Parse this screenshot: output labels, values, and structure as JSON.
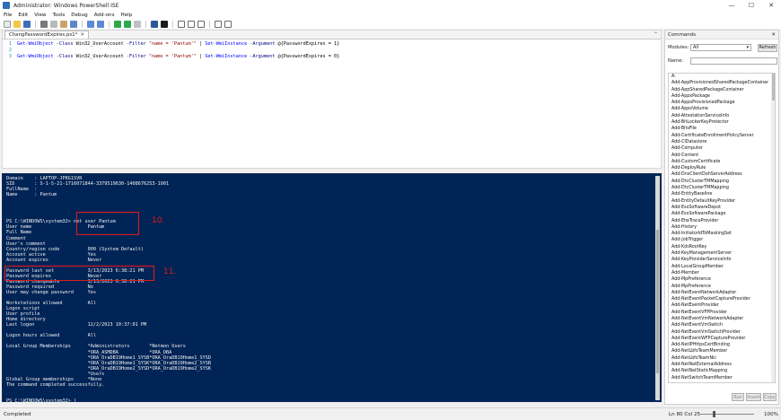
{
  "window": {
    "title": "Administrator: Windows PowerShell ISE",
    "controls": {
      "minimize": "—",
      "maximize": "☐",
      "close": "✕"
    }
  },
  "menu": [
    "File",
    "Edit",
    "View",
    "Tools",
    "Debug",
    "Add-ons",
    "Help"
  ],
  "editor": {
    "tab_label": "ChangPasswordExpires.ps1*",
    "tab_close": "✕",
    "collapse_glyph": "⌃",
    "lines": [
      {
        "n": "1",
        "parts": [
          {
            "c": "cmd",
            "t": "Get-WmiObject"
          },
          {
            "c": "param",
            "t": " -Class "
          },
          {
            "c": "plain",
            "t": "Win32_UserAccount"
          },
          {
            "c": "param",
            "t": " -Filter "
          },
          {
            "c": "str",
            "t": "\"name = 'Pantum'\""
          },
          {
            "c": "plain",
            "t": " | "
          },
          {
            "c": "cmd",
            "t": "Set-WmiInstance"
          },
          {
            "c": "param",
            "t": " -Argument "
          },
          {
            "c": "plain",
            "t": "@{PasswordExpires = 1}"
          }
        ]
      },
      {
        "n": "2",
        "parts": []
      },
      {
        "n": "3",
        "parts": [
          {
            "c": "cmd",
            "t": "Get-WmiObject"
          },
          {
            "c": "param",
            "t": " -Class "
          },
          {
            "c": "plain",
            "t": "Win32_UserAccount"
          },
          {
            "c": "param",
            "t": " -Filter "
          },
          {
            "c": "str",
            "t": "\"name = 'Pantum'\""
          },
          {
            "c": "plain",
            "t": " | "
          },
          {
            "c": "cmd",
            "t": "Set-WmiInstance"
          },
          {
            "c": "param",
            "t": " -Argument "
          },
          {
            "c": "plain",
            "t": "@{PasswordExpires = 0}"
          }
        ]
      }
    ]
  },
  "console": {
    "lines": [
      "Domain    : LAPTOP-JPRG1SVR",
      "SID       : S-1-5-21-1716071844-3379519630-1408676253-1001",
      "FullName  :",
      "Name      : Pantum",
      "",
      "",
      "",
      "",
      "PS C:\\WINDOWS\\system32> net user Pantum",
      "User name                    Pantum",
      "Full Name",
      "Comment",
      "User's comment",
      "Country/region code          000 (System Default)",
      "Account active               Yes",
      "Account expires              Never",
      "",
      "Password last set            3/13/2023 6:38:21 PM",
      "Password expires             Never",
      "Password changeable          3/13/2023 6:38:21 PM",
      "Password required            No",
      "User may change password     Yes",
      "",
      "Workstations allowed         All",
      "Logon script",
      "User profile",
      "Home directory",
      "Last logon                   12/2/2023 10:37:01 PM",
      "",
      "Logon hours allowed          All",
      "",
      "Local Group Memberships      *Administrators       *Netmon Users",
      "                             *ORA_ASMDBA           *ORA_DBA",
      "                             *ORA_OraDB19Home1_SYSB*ORA_OraDB19Home1_SYSD",
      "                             *ORA_OraDB19Home1_SYSK*ORA_OraDB19Home2_SYSB",
      "                             *ORA_OraDB19Home2_SYSD*ORA_OraDB19Home2_SYSK",
      "                             *Users",
      "Global Group memberships     *None",
      "The command completed successfully.",
      "",
      "",
      "PS C:\\WINDOWS\\system32> |"
    ],
    "annotations": [
      {
        "label": "10."
      },
      {
        "label": "11."
      }
    ]
  },
  "commands": {
    "panel_title": "Commands",
    "close_glyph": "✕",
    "modules_label": "Modules:",
    "modules_value": "All",
    "refresh_label": "Refresh",
    "name_label": "Name:",
    "name_value": "",
    "items": [
      "A:",
      "Add-AppProvisionedSharedPackageContainer",
      "Add-AppSharedPackageContainer",
      "Add-AppxPackage",
      "Add-AppxProvisionedPackage",
      "Add-AppxVolume",
      "Add-AttestationServiceInfo",
      "Add-BitLockerKeyProtector",
      "Add-BitsFile",
      "Add-CertificateEnrollmentPolicyServer",
      "Add-CIDatastore",
      "Add-Computer",
      "Add-Content",
      "Add-CustomCertificate",
      "Add-DeployRule",
      "Add-DnsClientDohServerAddress",
      "Add-DtcClusterTMMapping",
      "Add-DtcClusterTMMapping",
      "Add-EntityBaseline",
      "Add-EntityDefaultKeyProvider",
      "Add-EsxSoftwareDepot",
      "Add-EsxSoftwarePackage",
      "Add-EtwTraceProvider",
      "Add-History",
      "Add-InitiatorIdToMaskingSet",
      "Add-JobTrigger",
      "Add-KdsRootKey",
      "Add-KeyManagementServer",
      "Add-KeyProviderServiceInfo",
      "Add-LocalGroupMember",
      "Add-Member",
      "Add-MpPreference",
      "Add-MpPreference",
      "Add-NetEventNetworkAdapter",
      "Add-NetEventPacketCaptureProvider",
      "Add-NetEventProvider",
      "Add-NetEventVFPProvider",
      "Add-NetEventVmNetworkAdapter",
      "Add-NetEventVmSwitch",
      "Add-NetEventVmSwitchProvider",
      "Add-NetEventWFPCaptureProvider",
      "Add-NetIPHttpsCertBinding",
      "Add-NetLbfoTeamMember",
      "Add-NetLbfoTeamNic",
      "Add-NetNatExternalAddress",
      "Add-NetNatStaticMapping",
      "Add-NetSwitchTeamMember"
    ],
    "footer_buttons": [
      "Run",
      "Insert",
      "Copy"
    ]
  },
  "status": {
    "left": "Completed",
    "position": "Ln 80  Col 25",
    "zoom": "100%"
  },
  "colors": {
    "console_bg": "#012456",
    "annotation": "#e21b1b"
  }
}
